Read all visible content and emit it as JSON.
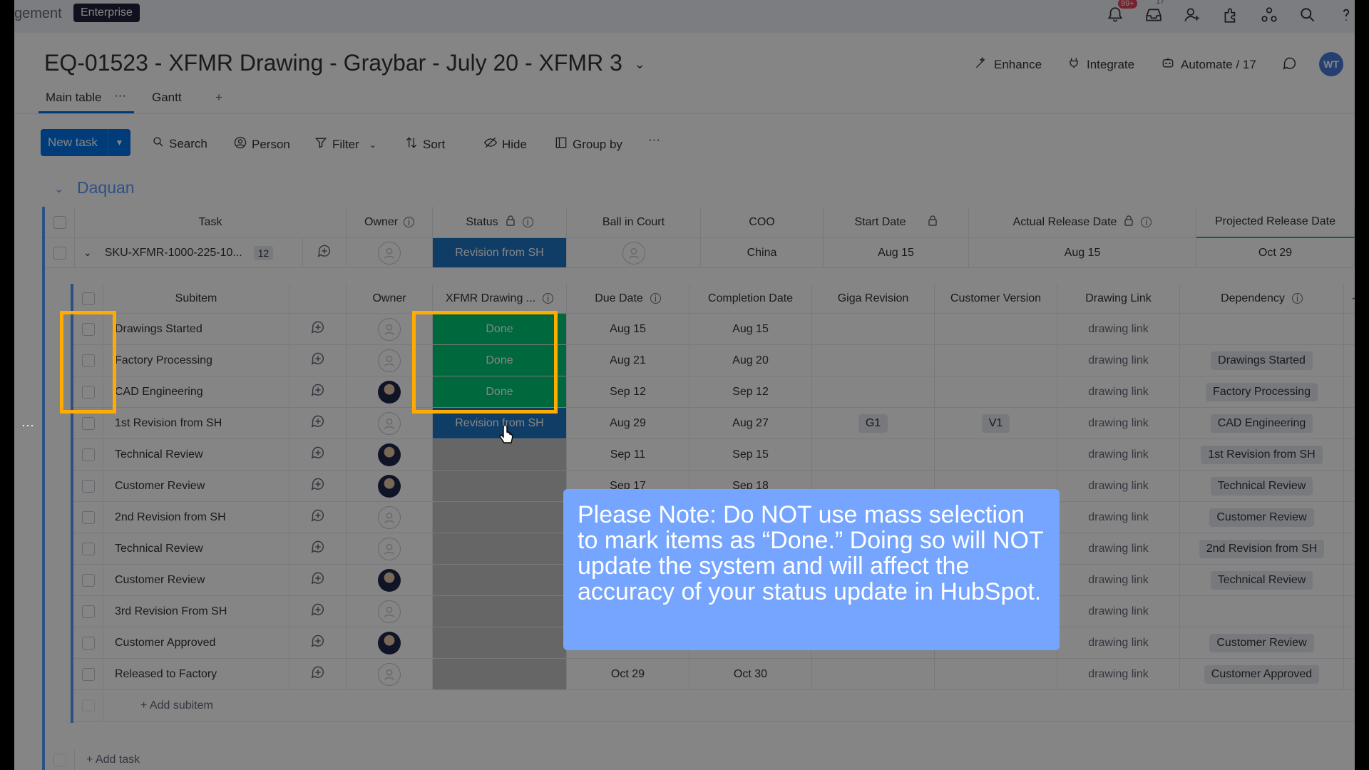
{
  "topbar": {
    "breadcrumb": "gement",
    "plan_badge": "Enterprise",
    "notifications_badge": "99+",
    "inbox_count": "17",
    "icons": [
      "bell-icon",
      "inbox-icon",
      "invite-members-icon",
      "apps-icon",
      "integrations-icon",
      "search-icon",
      "help-icon"
    ]
  },
  "board": {
    "title": "EQ-01523 - XFMR Drawing - Graybar - July 20 - XFMR 3",
    "actions": {
      "enhance": "Enhance",
      "integrate": "Integrate",
      "automate": "Automate / 17"
    },
    "avatar_initials": "WT",
    "tabs": [
      {
        "label": "Main table",
        "more": "···"
      },
      {
        "label": "Gantt"
      },
      {
        "label": "+"
      }
    ]
  },
  "toolbar": {
    "new_task": "New task",
    "search": "Search",
    "person": "Person",
    "filter": "Filter",
    "sort": "Sort",
    "hide": "Hide",
    "group_by": "Group by",
    "more": "···"
  },
  "group": {
    "name": "Daquan",
    "columns": [
      "Task",
      "Owner",
      "Status",
      "Ball in Court",
      "COO",
      "Start Date",
      "Actual Release Date",
      "Projected Release Date"
    ],
    "item": {
      "name": "SKU-XFMR-1000-225-10...",
      "subitem_count": "12",
      "status": "Revision from SH",
      "coo": "China",
      "start_date": "Aug 15",
      "actual_release_date": "Aug 15",
      "projected_release_date": "Oct 29"
    },
    "add_task": "+ Add task"
  },
  "subitems": {
    "columns": [
      "Subitem",
      "Owner",
      "XFMR Drawing ...",
      "Due Date",
      "Completion Date",
      "Giga Revision",
      "Customer Version",
      "Drawing Link",
      "Dependency"
    ],
    "add_column": "+",
    "rows": [
      {
        "name": "Drawings Started",
        "owner": "empty",
        "status": "Done",
        "due": "Aug 15",
        "completion": "Aug 15",
        "giga": "",
        "version": "",
        "link": "drawing link",
        "dependency": ""
      },
      {
        "name": "Factory Processing",
        "owner": "empty",
        "status": "Done",
        "due": "Aug 21",
        "completion": "Aug 20",
        "giga": "",
        "version": "",
        "link": "drawing link",
        "dependency": "Drawings Started"
      },
      {
        "name": "CAD Engineering",
        "owner": "photo",
        "status": "Done",
        "due": "Sep 12",
        "completion": "Sep 12",
        "giga": "",
        "version": "",
        "link": "drawing link",
        "dependency": "Factory Processing"
      },
      {
        "name": "1st Revision from SH",
        "owner": "empty",
        "status": "Revision from SH",
        "due": "Aug 29",
        "completion": "Aug 27",
        "giga": "G1",
        "version": "V1",
        "link": "drawing link",
        "dependency": "CAD Engineering"
      },
      {
        "name": "Technical Review",
        "owner": "photo",
        "status": "",
        "due": "Sep 11",
        "completion": "Sep 15",
        "giga": "",
        "version": "",
        "link": "drawing link",
        "dependency": "1st Revision from SH"
      },
      {
        "name": "Customer Review",
        "owner": "photo",
        "status": "",
        "due": "Sep 17",
        "completion": "Sep 18",
        "giga": "",
        "version": "",
        "link": "drawing link",
        "dependency": "Technical Review"
      },
      {
        "name": "2nd Revision from SH",
        "owner": "empty",
        "status": "",
        "due": "",
        "completion": "",
        "giga": "",
        "version": "",
        "link": "drawing link",
        "dependency": "Customer Review"
      },
      {
        "name": "Technical Review",
        "owner": "empty",
        "status": "",
        "due": "",
        "completion": "",
        "giga": "",
        "version": "",
        "link": "drawing link",
        "dependency": "2nd Revision from SH"
      },
      {
        "name": "Customer Review",
        "owner": "photo",
        "status": "",
        "due": "",
        "completion": "",
        "giga": "",
        "version": "",
        "link": "drawing link",
        "dependency": "Technical Review"
      },
      {
        "name": "3rd Revision From SH",
        "owner": "empty",
        "status": "",
        "due": "",
        "completion": "",
        "giga": "",
        "version": "",
        "link": "drawing link",
        "dependency": ""
      },
      {
        "name": "Customer Approved",
        "owner": "photo",
        "status": "",
        "due": "",
        "completion": "",
        "giga": "",
        "version": "",
        "link": "drawing link",
        "dependency": "Customer Review"
      },
      {
        "name": "Released to Factory",
        "owner": "empty",
        "status": "",
        "due": "Oct 29",
        "completion": "Oct 30",
        "giga": "",
        "version": "",
        "link": "drawing link",
        "dependency": "Customer Approved"
      }
    ],
    "add_subitem": "+ Add subitem"
  },
  "note": {
    "text": "Please Note:  Do NOT use mass selection to mark items as “Done.” Doing so will NOT update the system and will affect the accuracy of your status update in HubSpot."
  },
  "colors": {
    "done": "#00c875",
    "revision": "#1f76c2",
    "highlight": "#ffab00",
    "note_bg": "#75a5ff",
    "group_accent": "#579bfc",
    "primary": "#0073ea"
  }
}
